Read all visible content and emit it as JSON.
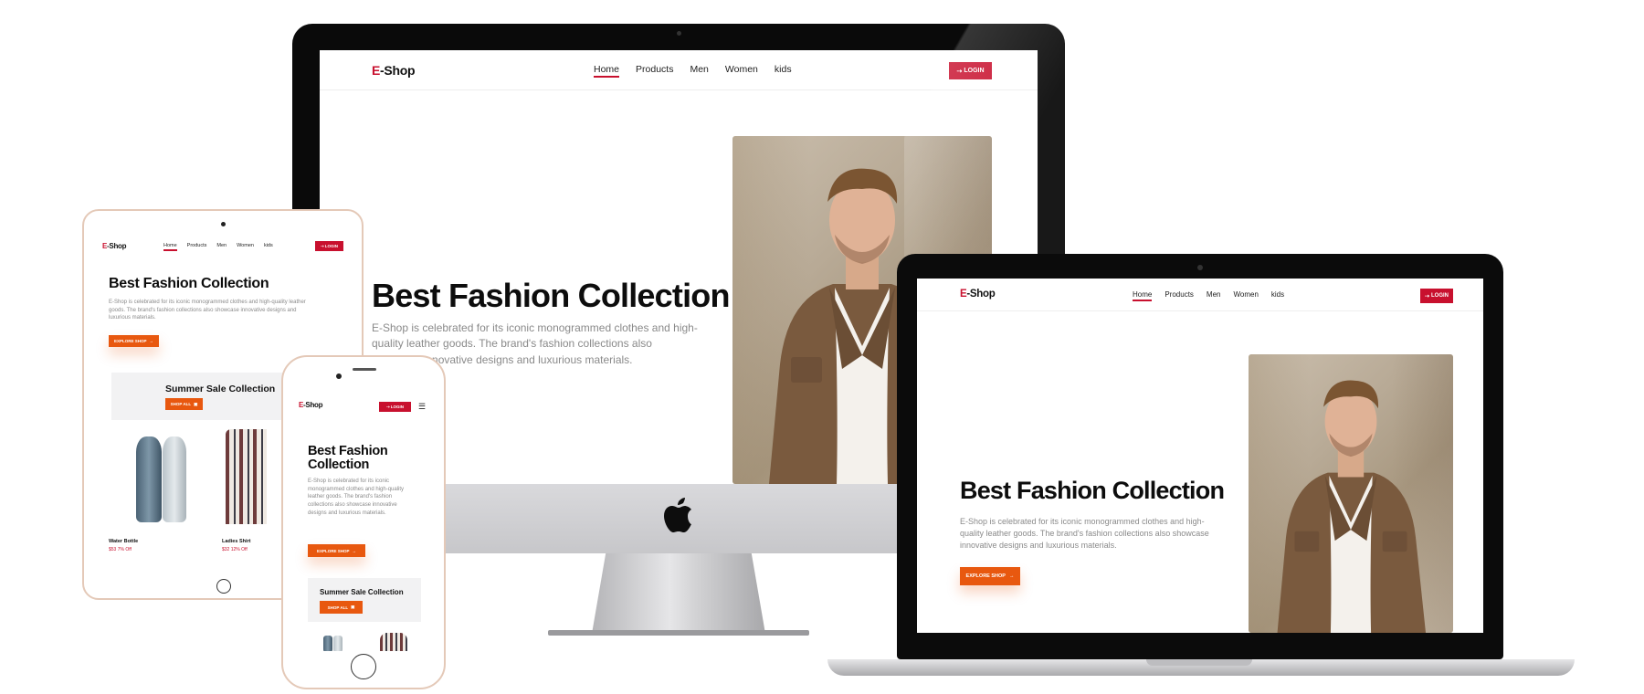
{
  "brand": {
    "logo_mark": "E",
    "logo_rest": "-Shop",
    "accent": "#c8102e",
    "cta_color": "#e8580f"
  },
  "nav": {
    "links": [
      "Home",
      "Products",
      "Men",
      "Women",
      "kids"
    ],
    "active": "Home",
    "login_label": "LOGIN",
    "login_icon": "login-arrow-icon"
  },
  "hero": {
    "title": "Best Fashion Collection",
    "description": "E-Shop is celebrated for its iconic monogrammed clothes and high-quality leather goods. The brand's fashion collections also showcase innovative designs and luxurious materials.",
    "cta_label": "EXPLORE SHOP",
    "cta_icon": "arrow-right-icon"
  },
  "sale": {
    "title": "Summer Sale Collection",
    "button_label": "SHOP ALL",
    "button_icon": "shopping-bag-icon"
  },
  "products": [
    {
      "name": "Water Bottle",
      "price": "$53",
      "discount": "7% Off"
    },
    {
      "name": "Ladies Shirt",
      "price": "$32",
      "discount": "12% Off"
    }
  ],
  "devices": [
    "imac",
    "laptop",
    "tablet",
    "phone"
  ]
}
